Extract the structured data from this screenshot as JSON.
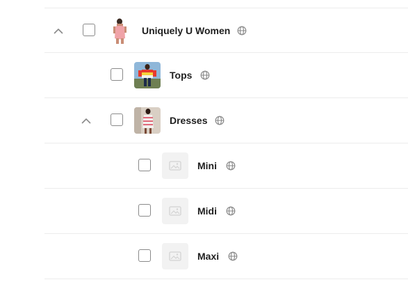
{
  "collections": [
    {
      "id": "uniquely-u-women",
      "label": "Uniquely U Women",
      "expanded": true,
      "has_image": true,
      "visibility_icon": "globe-icon",
      "children": [
        {
          "label": "Tops",
          "has_image": true,
          "visibility_icon": "globe-icon"
        },
        {
          "label": "Dresses",
          "expanded": true,
          "has_image": true,
          "visibility_icon": "globe-icon",
          "children": [
            {
              "label": "Mini",
              "has_image": false,
              "visibility_icon": "globe-icon"
            },
            {
              "label": "Midi",
              "has_image": false,
              "visibility_icon": "globe-icon"
            },
            {
              "label": "Maxi",
              "has_image": false,
              "visibility_icon": "globe-icon"
            }
          ]
        }
      ]
    }
  ],
  "colors": {
    "divider": "#ececec",
    "text": "#1f1f1f",
    "checkbox_border": "#8a8a8a",
    "placeholder_bg": "#f2f2f2",
    "icon_gray": "#8a8a8a"
  }
}
